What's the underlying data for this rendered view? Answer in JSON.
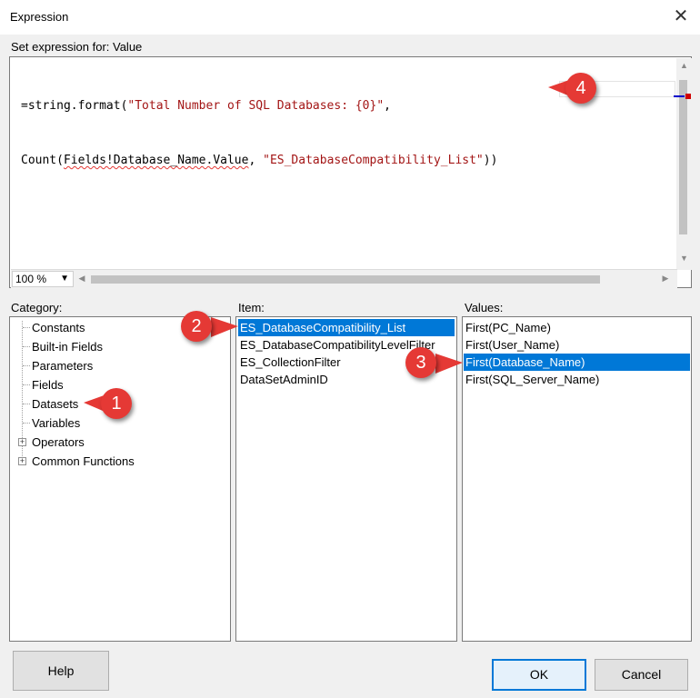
{
  "window": {
    "title": "Expression",
    "close_icon": "close-icon"
  },
  "expression": {
    "label": "Set expression for: Value",
    "line1_prefix": "=string.format(",
    "line1_string": "\"Total Number of SQL Databases: {0}\"",
    "line1_suffix": ",",
    "line2_func": "Count(",
    "line2_field": "Fields!Database_Name.Value",
    "line2_sep": ", ",
    "line2_string": "\"ES_DatabaseCompatibility_List\"",
    "line2_suffix": "))",
    "zoom": "100 %"
  },
  "category": {
    "label": "Category:",
    "items": [
      "Constants",
      "Built-in Fields",
      "Parameters",
      "Fields",
      "Datasets",
      "Variables",
      "Operators",
      "Common Functions"
    ]
  },
  "item": {
    "label": "Item:",
    "items": [
      "ES_DatabaseCompatibility_List",
      "ES_DatabaseCompatibilityLevelFilter",
      "ES_CollectionFilter",
      "DataSetAdminID"
    ],
    "selected": "ES_DatabaseCompatibility_List"
  },
  "values": {
    "label": "Values:",
    "items": [
      "First(PC_Name)",
      "First(User_Name)",
      "First(Database_Name)",
      "First(SQL_Server_Name)"
    ],
    "selected": "First(Database_Name)"
  },
  "buttons": {
    "help": "Help",
    "ok": "OK",
    "cancel": "Cancel"
  },
  "callouts": [
    "1",
    "2",
    "3",
    "4"
  ],
  "colors": {
    "selection": "#0078d7",
    "callout": "#e53935",
    "string": "#a31515"
  }
}
